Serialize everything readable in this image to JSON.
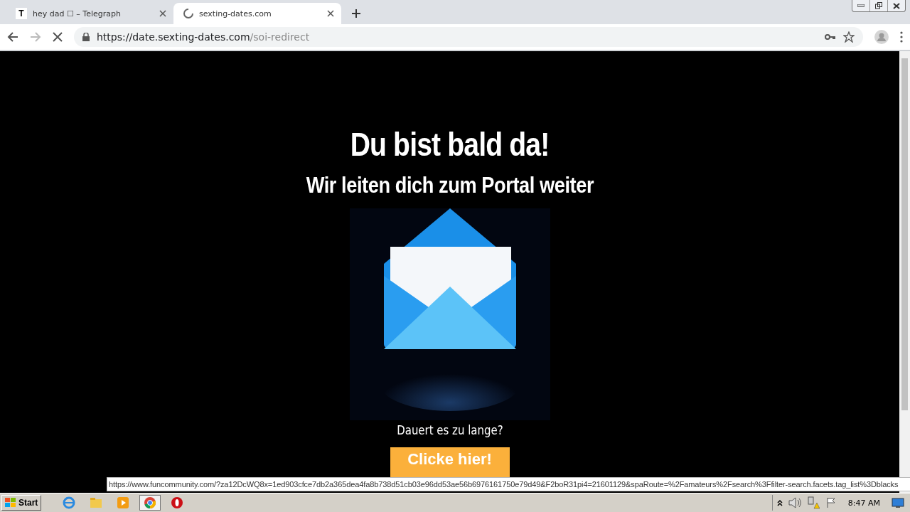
{
  "browser": {
    "tabs": [
      {
        "favicon": "T",
        "title": "hey dad ☐ – Telegraph",
        "selected": false,
        "loading": false
      },
      {
        "title": "sexting-dates.com",
        "selected": true,
        "loading": true
      }
    ],
    "address": {
      "origin": "https://date.sexting-dates.com",
      "path": "/soi-redirect"
    }
  },
  "page": {
    "heading": "Du bist bald da!",
    "subheading": "Wir leiten dich zum Portal weiter",
    "prompt": "Dauert es zu lange?",
    "button": "Clicke hier!"
  },
  "status_url": "https://www.funcommunity.com/?za12DcWQ8x=1ed903cfce7db2a365dea4fa8b738d51cb03e96dd53ae56b6976161750e79d49&F2boR31pi4=21601129&spaRoute=%2Famateurs%2Fsearch%3Ffilter-search.facets.tag_list%3Dblacks",
  "taskbar": {
    "start": "Start",
    "apps": [
      {
        "kind": "ie",
        "selected": false
      },
      {
        "kind": "folder",
        "selected": false
      },
      {
        "kind": "media",
        "selected": false
      },
      {
        "kind": "chrome",
        "selected": true
      },
      {
        "kind": "opera",
        "selected": false
      }
    ],
    "clock": "8:47 AM"
  }
}
